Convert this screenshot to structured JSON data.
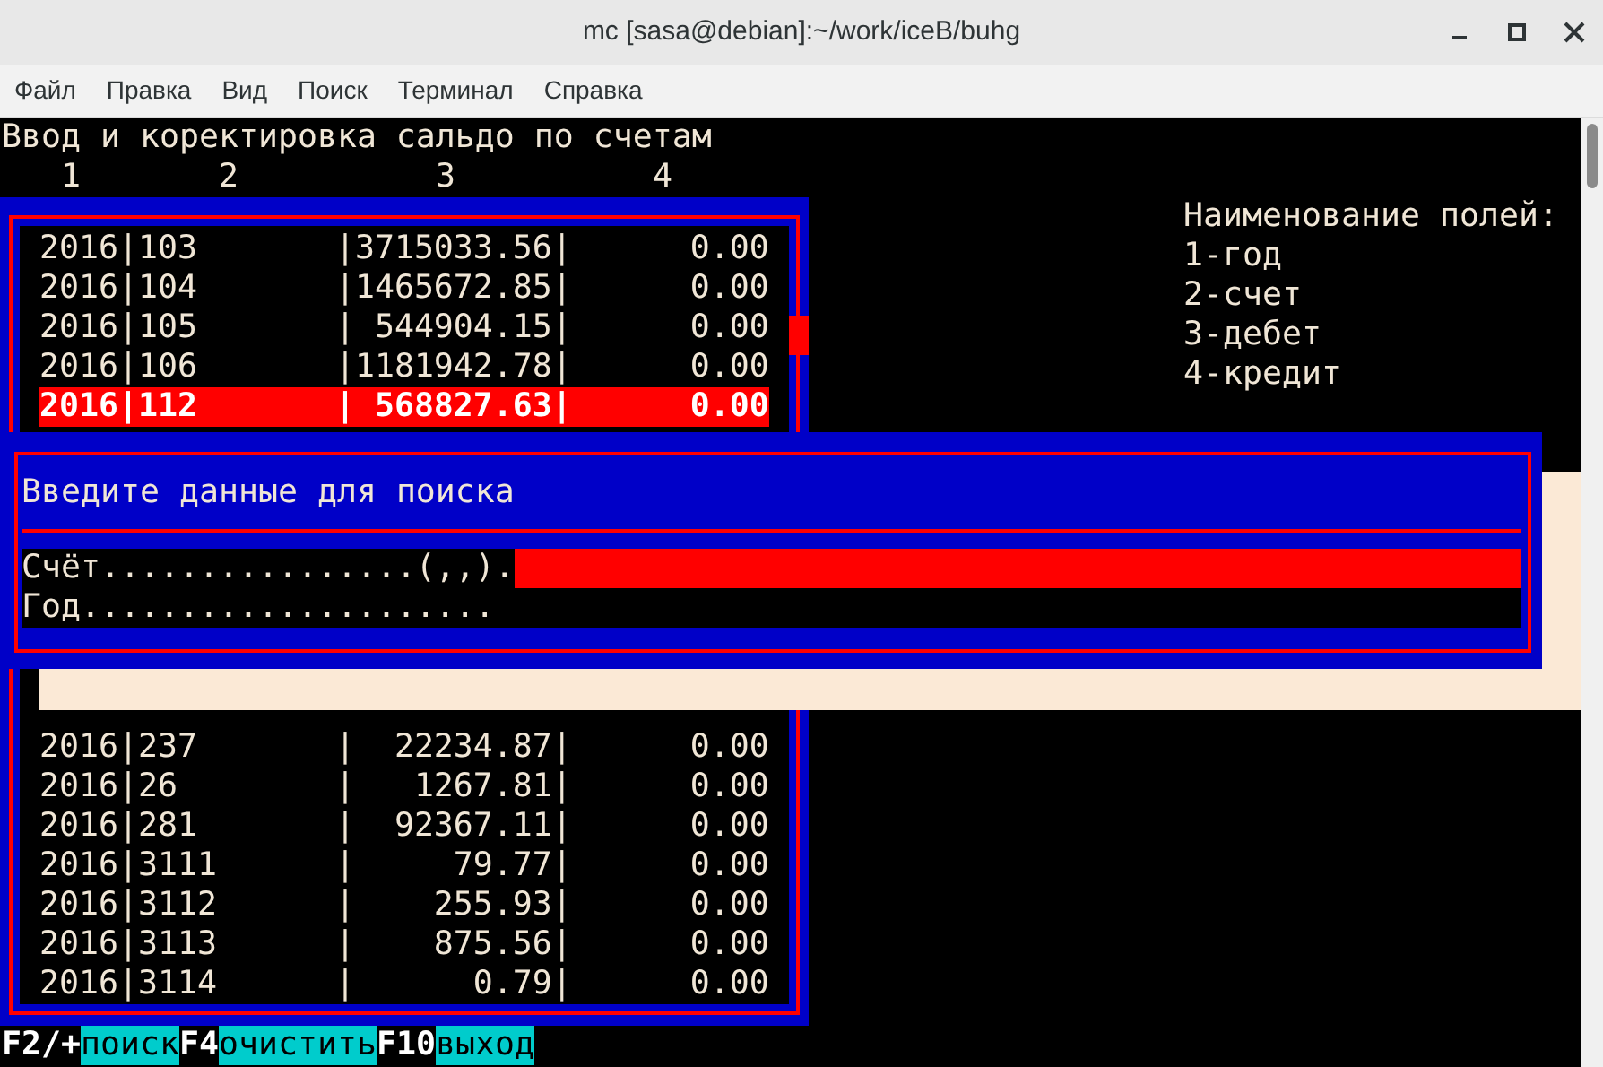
{
  "window": {
    "title": "mc [sasa@debian]:~/work/iceB/buhg"
  },
  "menu": [
    "Файл",
    "Правка",
    "Вид",
    "Поиск",
    "Терминал",
    "Справка"
  ],
  "screen_title": "Ввод и коректировка сальдо по счетам",
  "column_numbers": [
    "1",
    "2",
    "3",
    "4"
  ],
  "table": {
    "upper_rows": [
      {
        "text": "2016|103       |3715033.56|      0.00",
        "selected": false
      },
      {
        "text": "2016|104       |1465672.85|      0.00",
        "selected": false
      },
      {
        "text": "2016|105       | 544904.15|      0.00",
        "selected": false
      },
      {
        "text": "2016|106       |1181942.78|      0.00",
        "selected": false
      },
      {
        "text": "2016|112       | 568827.63|      0.00",
        "selected": true
      }
    ],
    "lower_rows": [
      {
        "text": "2016|237       |  22234.87|      0.00",
        "selected": false
      },
      {
        "text": "2016|26        |   1267.81|      0.00",
        "selected": false
      },
      {
        "text": "2016|281       |  92367.11|      0.00",
        "selected": false
      },
      {
        "text": "2016|3111      |     79.77|      0.00",
        "selected": false
      },
      {
        "text": "2016|3112      |    255.93|      0.00",
        "selected": false
      },
      {
        "text": "2016|3113      |    875.56|      0.00",
        "selected": false
      },
      {
        "text": "2016|3114      |      0.79|      0.00",
        "selected": false
      }
    ]
  },
  "field_names": {
    "title": "Наименование полей:",
    "items": [
      "1-год",
      "2-счет",
      "3-дебет",
      "4-кредит"
    ]
  },
  "dialog": {
    "title": "Введите данные для поиска",
    "fields": [
      {
        "label": "Счёт................(,,).",
        "focused": true
      },
      {
        "label": "Год.....................",
        "focused": false
      }
    ]
  },
  "status_bar": [
    {
      "key": "F2/+",
      "action": "поиск"
    },
    {
      "key": "F4",
      "action": "очистить"
    },
    {
      "key": "F10",
      "action": "выход"
    }
  ]
}
